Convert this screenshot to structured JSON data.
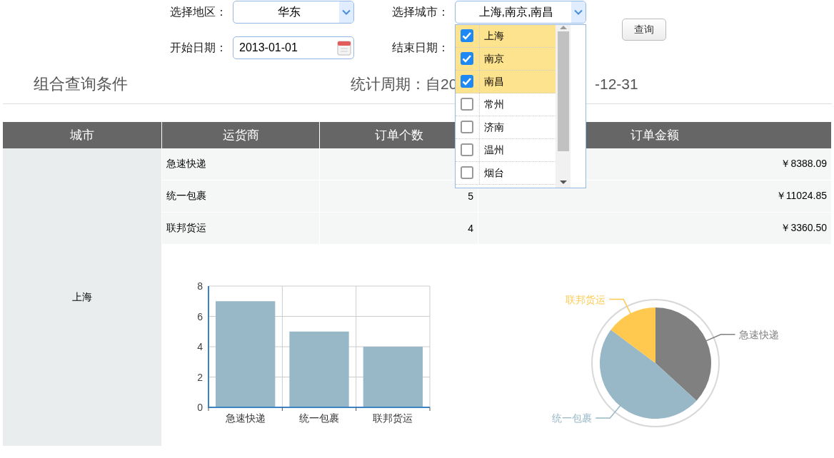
{
  "filters": {
    "region": {
      "label": "选择地区：",
      "value": "华东"
    },
    "city": {
      "label": "选择城市：",
      "value": "上海,南京,南昌",
      "options": [
        {
          "label": "上海",
          "checked": true
        },
        {
          "label": "南京",
          "checked": true
        },
        {
          "label": "南昌",
          "checked": true
        },
        {
          "label": "常州",
          "checked": false
        },
        {
          "label": "济南",
          "checked": false
        },
        {
          "label": "温州",
          "checked": false
        },
        {
          "label": "烟台",
          "checked": false
        }
      ]
    },
    "start_date": {
      "label": "开始日期：",
      "value": "2013-01-01"
    },
    "end_date": {
      "label": "结束日期："
    },
    "query_button": "查询"
  },
  "section_title": "组合查询条件",
  "period": {
    "left": "统计周期：自20",
    "right": "-12-31"
  },
  "table": {
    "columns": [
      "城市",
      "运货商",
      "订单个数",
      "订单金额"
    ],
    "city": "上海",
    "rows": [
      {
        "carrier": "急速快递",
        "amount": "￥8388.09"
      },
      {
        "carrier": "统一包裹",
        "count": "5",
        "amount": "￥11024.85"
      },
      {
        "carrier": "联邦货运",
        "count": "4",
        "amount": "￥3360.50"
      }
    ],
    "bar_chart": {
      "chart_data": {
        "type": "bar",
        "categories": [
          "急速快递",
          "统一包裹",
          "联邦货运"
        ],
        "series": [
          {
            "color": "#98b8c8",
            "values": [
              7,
              5,
              4
            ]
          }
        ],
        "ylim": [
          0,
          8
        ],
        "yticks": [
          0,
          2,
          4,
          6,
          8
        ],
        "grid": true
      }
    },
    "pie_chart": {
      "chart_data": {
        "type": "pie",
        "categories": [
          "急速快递",
          "统一包裹",
          "联邦货运"
        ],
        "series": [
          {
            "values": [
              36.8,
              48.4,
              14.8
            ]
          }
        ],
        "colors": [
          "#808080",
          "#98b8c8",
          "#ffc94f"
        ]
      }
    }
  }
}
